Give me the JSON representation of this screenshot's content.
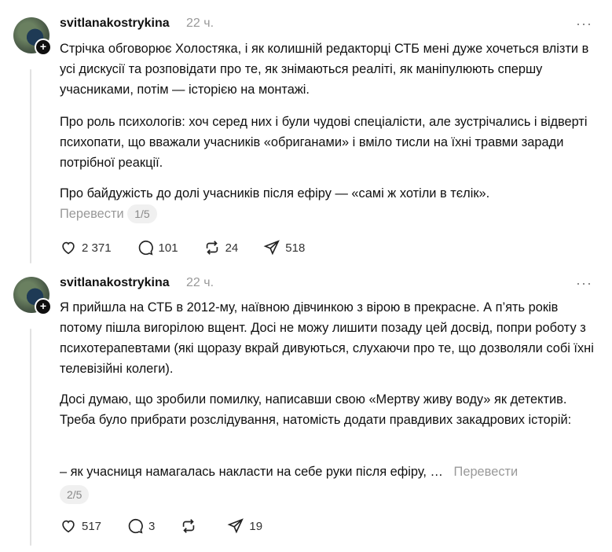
{
  "posts": [
    {
      "username": "svitlanakostrykina",
      "time": "22 ч.",
      "more": "···",
      "paragraphs": [
        "Стрічка обговорює Холостяка, і як колишній редакторці СТБ мені дуже хочеться влізти в усі дискусії та розповідати про те, як знімаються реаліті, як маніпулюють спершу учасниками, потім — історією на монтажі.",
        "Про роль психологів: хоч серед них і були чудові спеціалісти, але зустрічались і відверті психопати, що вважали учасників «обриганами» і вміло тисли на їхні травми заради потрібної реакції.",
        "Про байдужість до долі учасників після ефіру — «самі ж хотіли в тєлік»."
      ],
      "translate": "Перевести",
      "pager": "1/5",
      "likes": "2 371",
      "comments": "101",
      "reposts": "24",
      "shares": "518"
    },
    {
      "username": "svitlanakostrykina",
      "time": "22 ч.",
      "more": "···",
      "paragraphs": [
        "Я прийшла на СТБ в 2012-му, наївною дівчинкою з вірою в прекрасне. А п’ять років потому пішла вигорілою вщент. Досі не можу лишити позаду цей досвід, попри роботу з психотерапевтами (які щоразу вкрай дивуються, слухаючи про те, що дозволяли собі їхні телевізійні колеги).",
        "Досі думаю, що зробили помилку, написавши свою «Мертву живу воду» як детектив. Треба було прибрати розслідування, натомість додати правдивих закадрових історій:",
        "– як учасниця намагалась накласти на себе руки після ефіру, …"
      ],
      "translate": "Перевести",
      "pager": "2/5",
      "likes": "517",
      "comments": "3",
      "reposts": "",
      "shares": "19"
    }
  ]
}
